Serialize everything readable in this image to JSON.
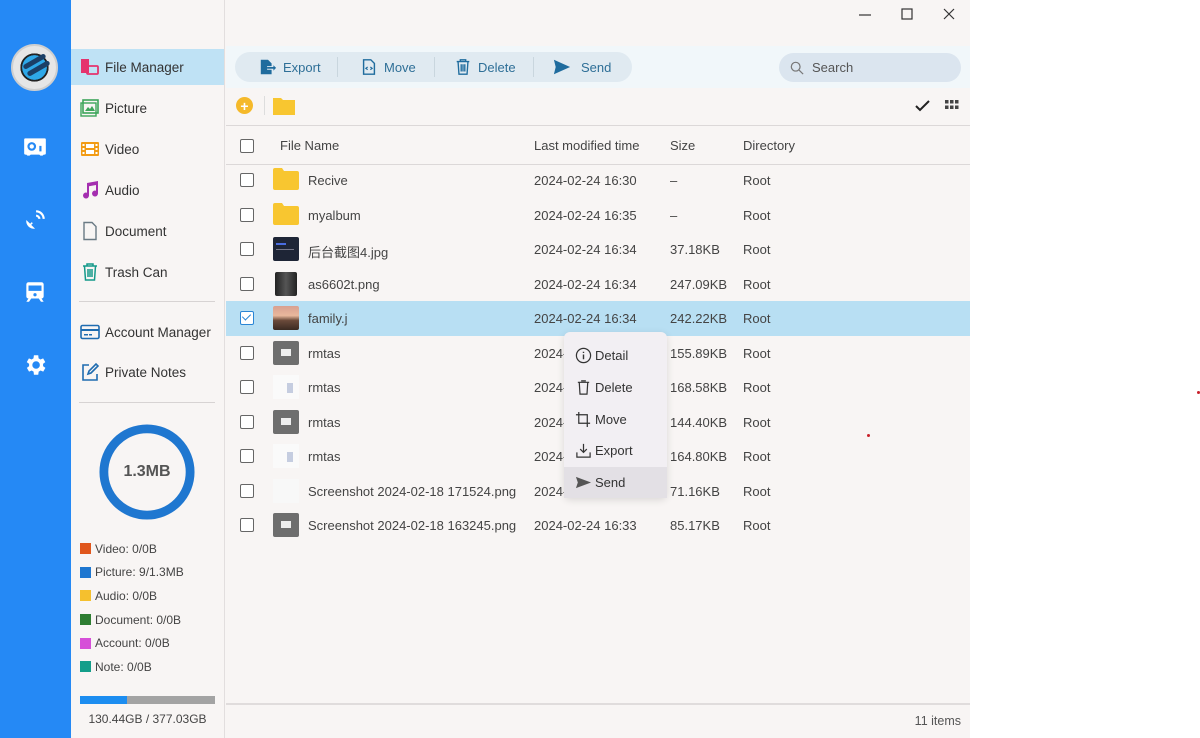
{
  "window": {
    "controls": [
      "minimize",
      "maximize",
      "close"
    ]
  },
  "rail": {
    "icons": [
      "app-logo",
      "storage-icon",
      "satellite-icon",
      "train-icon",
      "gear-icon"
    ]
  },
  "sidebar": {
    "items": [
      {
        "label": "File Manager",
        "icon": "file-manager-icon",
        "active": true
      },
      {
        "label": "Picture",
        "icon": "picture-icon"
      },
      {
        "label": "Video",
        "icon": "video-icon"
      },
      {
        "label": "Audio",
        "icon": "audio-icon"
      },
      {
        "label": "Document",
        "icon": "document-icon"
      },
      {
        "label": "Trash Can",
        "icon": "trash-icon"
      },
      {
        "label": "Account Manager",
        "icon": "account-icon"
      },
      {
        "label": "Private Notes",
        "icon": "notes-icon"
      }
    ],
    "usage": {
      "total_label": "1.3MB",
      "legend": [
        {
          "label": "Video: 0/0B",
          "color": "#e0561c"
        },
        {
          "label": "Picture: 9/1.3MB",
          "color": "#1f77d0"
        },
        {
          "label": "Audio: 0/0B",
          "color": "#f5c02e"
        },
        {
          "label": "Document: 0/0B",
          "color": "#2e7d32"
        },
        {
          "label": "Account: 0/0B",
          "color": "#d64fd8"
        },
        {
          "label": "Note: 0/0B",
          "color": "#149e8a"
        }
      ],
      "disk_used_fraction": 0.346,
      "disk_text": "130.44GB / 377.03GB"
    }
  },
  "toolbar": {
    "actions": [
      {
        "label": "Export",
        "icon": "export-icon"
      },
      {
        "label": "Move",
        "icon": "move-icon"
      },
      {
        "label": "Delete",
        "icon": "delete-icon"
      },
      {
        "label": "Send",
        "icon": "send-icon"
      }
    ],
    "search_placeholder": "Search"
  },
  "table": {
    "headers": {
      "name": "File Name",
      "modified": "Last modified time",
      "size": "Size",
      "directory": "Directory"
    },
    "rows": [
      {
        "name": "Recive",
        "modified": "2024-02-24 16:30",
        "size": "–",
        "directory": "Root",
        "type": "folder",
        "checked": false
      },
      {
        "name": "myalbum",
        "modified": "2024-02-24 16:35",
        "size": "–",
        "directory": "Root",
        "type": "folder",
        "checked": false
      },
      {
        "name": "后台截图4.jpg",
        "modified": "2024-02-24 16:34",
        "size": "37.18KB",
        "directory": "Root",
        "type": "dark-screenshot",
        "checked": false
      },
      {
        "name": "as6602t.png",
        "modified": "2024-02-24 16:34",
        "size": "247.09KB",
        "directory": "Root",
        "type": "device",
        "checked": false
      },
      {
        "name": "family.j",
        "modified": "2024-02-24 16:34",
        "size": "242.22KB",
        "directory": "Root",
        "type": "photo",
        "checked": true
      },
      {
        "name": "rmtas",
        "modified": "2024-02-24 16:33",
        "size": "155.89KB",
        "directory": "Root",
        "type": "gray",
        "checked": false
      },
      {
        "name": "rmtas",
        "modified": "2024-02-24 16:33",
        "size": "168.58KB",
        "directory": "Root",
        "type": "light",
        "checked": false
      },
      {
        "name": "rmtas",
        "modified": "2024-02-24 16:33",
        "size": "144.40KB",
        "directory": "Root",
        "type": "gray",
        "checked": false
      },
      {
        "name": "rmtas",
        "modified": "2024-02-24 16:33",
        "size": "164.80KB",
        "directory": "Root",
        "type": "light",
        "checked": false
      },
      {
        "name": "Screenshot 2024-02-18 171524.png",
        "modified": "2024-02-24 16:33",
        "size": "71.16KB",
        "directory": "Root",
        "type": "blank",
        "checked": false
      },
      {
        "name": "Screenshot 2024-02-18 163245.png",
        "modified": "2024-02-24 16:33",
        "size": "85.17KB",
        "directory": "Root",
        "type": "gray",
        "checked": false
      }
    ]
  },
  "context_menu": {
    "items": [
      {
        "label": "Detail",
        "icon": "info-icon"
      },
      {
        "label": "Delete",
        "icon": "trash-icon"
      },
      {
        "label": "Move",
        "icon": "crop-move-icon"
      },
      {
        "label": "Export",
        "icon": "download-icon"
      },
      {
        "label": "Send",
        "icon": "send-icon",
        "hover": true
      }
    ]
  },
  "status": {
    "item_count": "11 items"
  }
}
